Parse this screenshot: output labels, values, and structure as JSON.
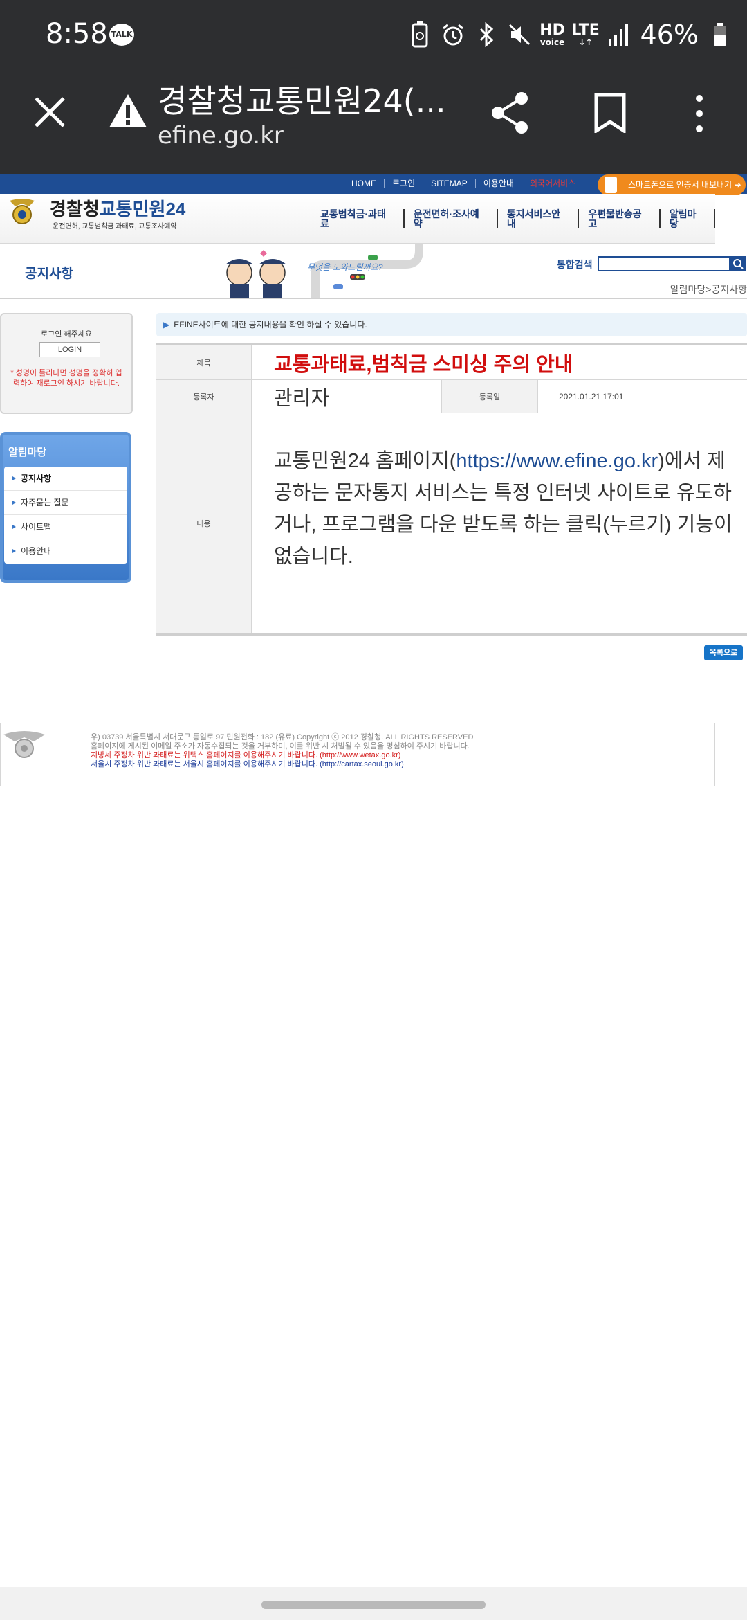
{
  "status_bar": {
    "time": "8:58",
    "talk_badge": "TALK",
    "hd_label": "HD",
    "voice_label": "voice",
    "lte_label": "LTE",
    "battery_percent": "46%"
  },
  "browser": {
    "page_title": "경찰청교통민원24(...",
    "url": "efine.go.kr"
  },
  "web": {
    "top_nav": [
      "HOME",
      "로그인",
      "SITEMAP",
      "이용안내",
      "외국어서비스"
    ],
    "smart_button": "스마트폰으로 인증서 내보내기",
    "logo": {
      "part1": "경찰청",
      "part2": "교통민원24",
      "subtitle": "운전면허, 교통범칙금 과태료, 교통조사예약"
    },
    "gnb": [
      "교통범칙금·과태료",
      "운전면허·조사예약",
      "통지서비스안내",
      "우편물반송공고",
      "알림마당"
    ],
    "section_title": "공지사항",
    "banner_text": "무엇을 도와드릴까요?",
    "search_label": "통합검색",
    "search_placeholder": "",
    "breadcrumb": "알림마당>공지사항",
    "login": {
      "prompt": "로그인 해주세요",
      "button": "LOGIN",
      "notice": "* 성명이 틀리다면 성명을 정확히 입력하여 재로그인 하시기 바랍니다."
    },
    "side_menu": {
      "title": "알림마당",
      "items": [
        "공지사항",
        "자주묻는 질문",
        "사이트맵",
        "이용안내"
      ]
    },
    "info_strip": "EFINE사이트에 대한 공지내용을 확인 하실 수 있습니다.",
    "notice": {
      "subject_label": "제목",
      "subject": "교통과태료,범칙금 스미싱 주의 안내",
      "author_label": "등록자",
      "author": "관리자",
      "date_label": "등록일",
      "date": "2021.01.21 17:01",
      "content_label": "내용",
      "content_pre": "교통민원24 홈페이지(",
      "content_link": "https://www.efine.go.kr",
      "content_post": ")에서 제공하는 문자통지 서비스는 특정 인터넷 사이트로 유도하거나, 프로그램을 다운 받도록 하는 클릭(누르기) 기능이 없습니다."
    },
    "list_button": "목록으로",
    "footer": {
      "line1": "우) 03739 서울특별시 서대문구 통일로 97 민원전화 : 182 (유료)     Copyright ⓒ 2012 경찰청. ALL RIGHTS RESERVED",
      "line2": "홈페이지에 게시된 이메일 주소가 자동수집되는 것을 거부하며, 이를 위반 시 처벌될 수 있음을 명심하여 주시기 바랍니다.",
      "line3": "지방세 주정차 위반 과태료는 위택스 홈페이지를 이용해주시기 바랍니다. (http://www.wetax.go.kr)",
      "line4": "서울시 주정차 위반 과태료는 서울시 홈페이지를 이용해주시기 바랍니다. (http://cartax.seoul.go.kr)"
    }
  },
  "colors": {
    "chrome_bg": "#2d2e30",
    "site_blue": "#1e4d94",
    "title_red": "#d10e0e",
    "accent_orange": "#f08a1d"
  }
}
